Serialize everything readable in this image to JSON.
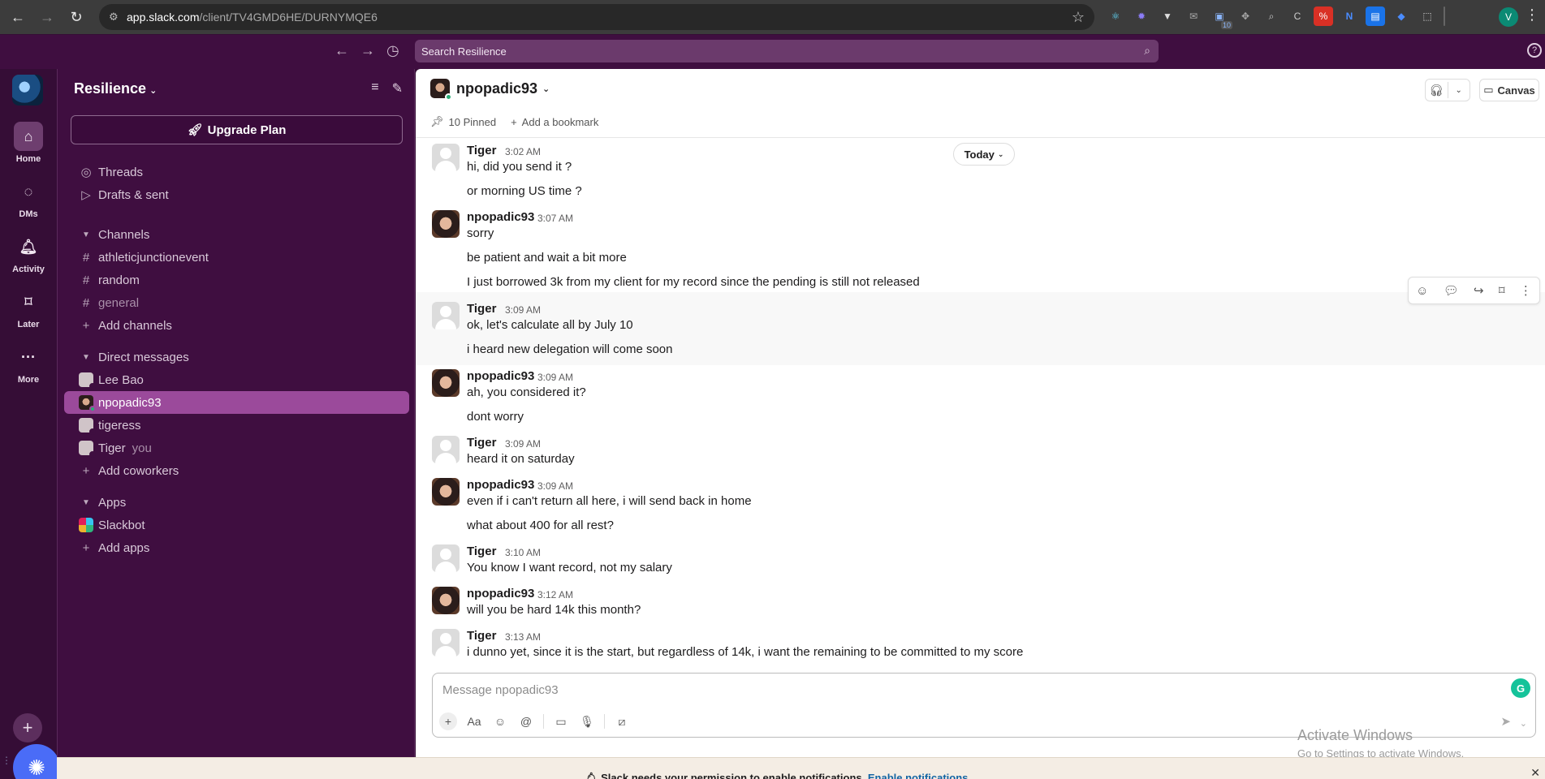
{
  "browser": {
    "url_host": "app.slack.com",
    "url_path": "/client/TV4GMD6HE/DURNYMQE6",
    "profile_initial": "V",
    "extension_badge": "10"
  },
  "topbar": {
    "search_placeholder": "Search Resilience"
  },
  "rail": {
    "items": [
      {
        "label": "Home",
        "icon": "home-icon"
      },
      {
        "label": "DMs",
        "icon": "dms-icon"
      },
      {
        "label": "Activity",
        "icon": "bell-icon"
      },
      {
        "label": "Later",
        "icon": "bookmark-icon"
      },
      {
        "label": "More",
        "icon": "more-icon"
      }
    ]
  },
  "sidebar": {
    "workspace": "Resilience",
    "upgrade_label": "Upgrade Plan",
    "threads": "Threads",
    "drafts": "Drafts & sent",
    "channels_header": "Channels",
    "channels": [
      "athleticjunctionevent",
      "random",
      "general"
    ],
    "add_channels": "Add channels",
    "dm_header": "Direct messages",
    "dms": [
      {
        "name": "Lee Bao",
        "suffix": ""
      },
      {
        "name": "npopadic93",
        "suffix": ""
      },
      {
        "name": "tigeress",
        "suffix": ""
      },
      {
        "name": "Tiger",
        "suffix": "you"
      }
    ],
    "add_coworkers": "Add coworkers",
    "apps_header": "Apps",
    "apps": [
      "Slackbot"
    ],
    "add_apps": "Add apps"
  },
  "channel": {
    "title": "npopadic93",
    "pinned": "10 Pinned",
    "add_bookmark": "Add a bookmark",
    "canvas": "Canvas",
    "date_divider": "Today"
  },
  "messages": [
    {
      "author": "Tiger",
      "time": "3:02 AM",
      "lines": [
        "hi, did you send it ?",
        "or morning US time ?"
      ]
    },
    {
      "author": "npopadic93",
      "time": "3:07 AM",
      "lines": [
        "sorry",
        "be patient and wait a bit more",
        "I just borrowed 3k from my client for my record since the pending is still not released"
      ]
    },
    {
      "author": "Tiger",
      "time": "3:09 AM",
      "lines": [
        "ok, let's calculate all by July 10",
        "i heard new delegation will come soon"
      ]
    },
    {
      "author": "npopadic93",
      "time": "3:09 AM",
      "lines": [
        "ah, you considered it?",
        "dont worry"
      ]
    },
    {
      "author": "Tiger",
      "time": "3:09 AM",
      "lines": [
        "heard it on saturday"
      ]
    },
    {
      "author": "npopadic93",
      "time": "3:09 AM",
      "lines": [
        "even if i can't return all here, i will send back in home",
        "what about 400 for all rest?"
      ]
    },
    {
      "author": "Tiger",
      "time": "3:10 AM",
      "lines": [
        "You know I want record, not my salary"
      ]
    },
    {
      "author": "npopadic93",
      "time": "3:12 AM",
      "lines": [
        "will you be hard 14k this month?"
      ]
    },
    {
      "author": "Tiger",
      "time": "3:13 AM",
      "lines": [
        "i dunno yet, since it is the start, but regardless of 14k, i want the remaining to be committed to my score"
      ]
    }
  ],
  "composer": {
    "placeholder": "Message npopadic93"
  },
  "watermark": {
    "line1": "Activate Windows",
    "line2": "Go to Settings to activate Windows."
  },
  "notification": {
    "text": "Slack needs your permission to enable notifications.",
    "link": "Enable notifications"
  },
  "colors": {
    "sidebar_bg": "#3f0e40",
    "active_item": "#9b4a9b",
    "online": "#2bac76",
    "link": "#1264a3"
  }
}
